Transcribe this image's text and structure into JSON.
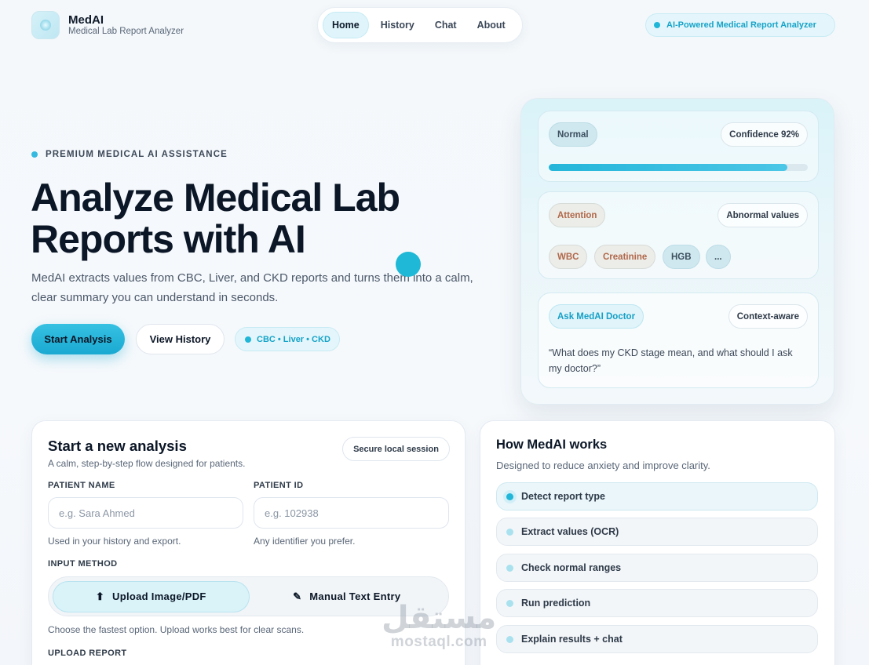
{
  "brand": {
    "name": "MedAI",
    "subtitle": "Medical Lab Report Analyzer"
  },
  "nav": {
    "items": [
      "Home",
      "History",
      "Chat",
      "About"
    ],
    "active": "Home"
  },
  "header_badge": "AI-Powered Medical Report Analyzer",
  "hero": {
    "eyebrow": "PREMIUM MEDICAL AI ASSISTANCE",
    "title_line1": "Analyze Medical Lab",
    "title_line2": "Reports with AI",
    "subtitle_line1": "MedAI extracts values from CBC, Liver, and CKD reports and turns them into a calm,",
    "subtitle_line2": "clear summary you can understand in seconds.",
    "primary_button": "Start Analysis",
    "secondary_button": "View History",
    "tags_chip": "CBC • Liver • CKD"
  },
  "preview": {
    "status": "Normal",
    "confidence_label": "Confidence 92%",
    "confidence_progress": 0.92,
    "attention_label": "Attention",
    "abnormal_label": "Abnormal values",
    "abnormal_items": [
      "WBC",
      "Creatinine",
      "HGB",
      "..."
    ],
    "ask_label": "Ask MedAI Doctor",
    "context_label": "Context-aware",
    "quote_line1": "“What does my CKD stage mean, and what should I ask",
    "quote_line2": "my doctor?”"
  },
  "analysis_form": {
    "title": "Start a new analysis",
    "subtitle": "A calm, step-by-step flow designed for patients.",
    "secure_badge": "Secure local session",
    "patient_name_label": "PATIENT NAME",
    "patient_name_placeholder": "e.g. Sara Ahmed",
    "patient_name_hint": "Used in your history and export.",
    "patient_id_label": "PATIENT ID",
    "patient_id_placeholder": "e.g. 102938",
    "patient_id_hint": "Any identifier you prefer.",
    "input_method_label": "INPUT METHOD",
    "upload_option": "Upload Image/PDF",
    "manual_option": "Manual Text Entry",
    "method_hint": "Choose the fastest option. Upload works best for clear scans.",
    "upload_label": "UPLOAD REPORT"
  },
  "how_it_works": {
    "title": "How MedAI works",
    "subtitle": "Designed to reduce anxiety and improve clarity.",
    "steps": [
      "Detect report type",
      "Extract values (OCR)",
      "Check normal ranges",
      "Run prediction",
      "Explain results + chat"
    ]
  },
  "watermark": {
    "arabic": "مستقل",
    "latin": "mostaql.com"
  }
}
